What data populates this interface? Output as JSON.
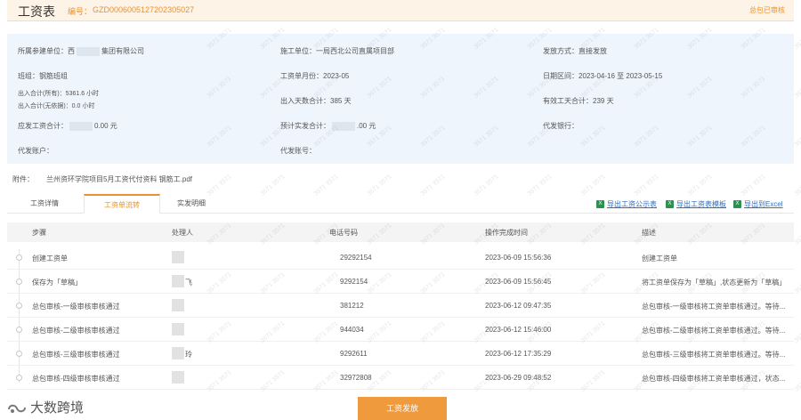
{
  "header": {
    "title": "工资表",
    "code_label": "编号：",
    "code": "GZD00060051272023050​27",
    "status": "总包已审核"
  },
  "info": {
    "unit_label": "所属参建单位：",
    "unit_value_a": "西",
    "unit_value_b": "集团有限公司",
    "construction_label": "施工单位：",
    "construction_value": "一局西北公司直属项目部",
    "pay_method_label": "发放方式：",
    "pay_method_value": "直接发放",
    "team_label": "班组：",
    "team_value": "钢筋班组",
    "month_label": "工资单月份：",
    "month_value": "2023-05",
    "date_range_label": "日期区间：",
    "date_range_value": "2023-04-16 至 2023-05-15",
    "attend_all_label": "出入合计(所有)：",
    "attend_all_value": "5361.6 小时",
    "attend_noeff_label": "出入合计(无依据)：",
    "attend_noeff_value": "0.0 小时",
    "days_label": "出入天数合计：",
    "days_value": "385 天",
    "work_days_label": "有效工天合计：",
    "work_days_value": "239 天",
    "should_pay_label": "应发工资合计：",
    "should_pay_value": "0.00 元",
    "real_pay_label": "预计实发合计：",
    "real_pay_value": ".00 元",
    "bank_label": "代发银行：",
    "account_label": "代发账户：",
    "account_no_label": "代发账号："
  },
  "attachment": {
    "label": "附件：",
    "file": "兰州资环学院项目5月工资代付资料 钢筋工.pdf"
  },
  "tabs": [
    "工资详情",
    "工资单流转",
    "实发明细"
  ],
  "exports": [
    "导出工资公示表",
    "导出工资表模板",
    "导出到Excel"
  ],
  "table": {
    "headers": [
      "步骤",
      "处理人",
      "电话号码",
      "操作完成时间",
      "描述"
    ],
    "rows": [
      {
        "step": "创建工资单",
        "handler": "",
        "phone": "29292154",
        "time": "2023-06-09 15:56:36",
        "desc": "创建工资单"
      },
      {
        "step": "保存为「草稿」",
        "handler": "飞",
        "phone": "9292154",
        "time": "2023-06-09 15:56:45",
        "desc": "将工资单保存为「草稿」,状态更新为「草稿」"
      },
      {
        "step": "总包审核-一级审核审核通过",
        "handler": "",
        "phone": "381212",
        "time": "2023-06-12 09:47:35",
        "desc": "总包审核-一级审核将工资单审核通过。等待..."
      },
      {
        "step": "总包审核-二级审核审核通过",
        "handler": "",
        "phone": "944034",
        "time": "2023-06-12 15:46:00",
        "desc": "总包审核-二级审核将工资单审核通过。等待..."
      },
      {
        "step": "总包审核-三级审核审核通过",
        "handler": "玲",
        "phone": "9292611",
        "time": "2023-06-12 17:35:29",
        "desc": "总包审核-三级审核将工资单审核通过。等待..."
      },
      {
        "step": "总包审核-四级审核审核通过",
        "handler": "",
        "phone": "32972808",
        "time": "2023-06-29 09:48:52",
        "desc": "总包审核-四级审核将工资单审核通过，状态..."
      }
    ]
  },
  "footer": {
    "submit_label": "工资发放",
    "logo_text": "大数跨境"
  },
  "watermark": "3571 3571"
}
